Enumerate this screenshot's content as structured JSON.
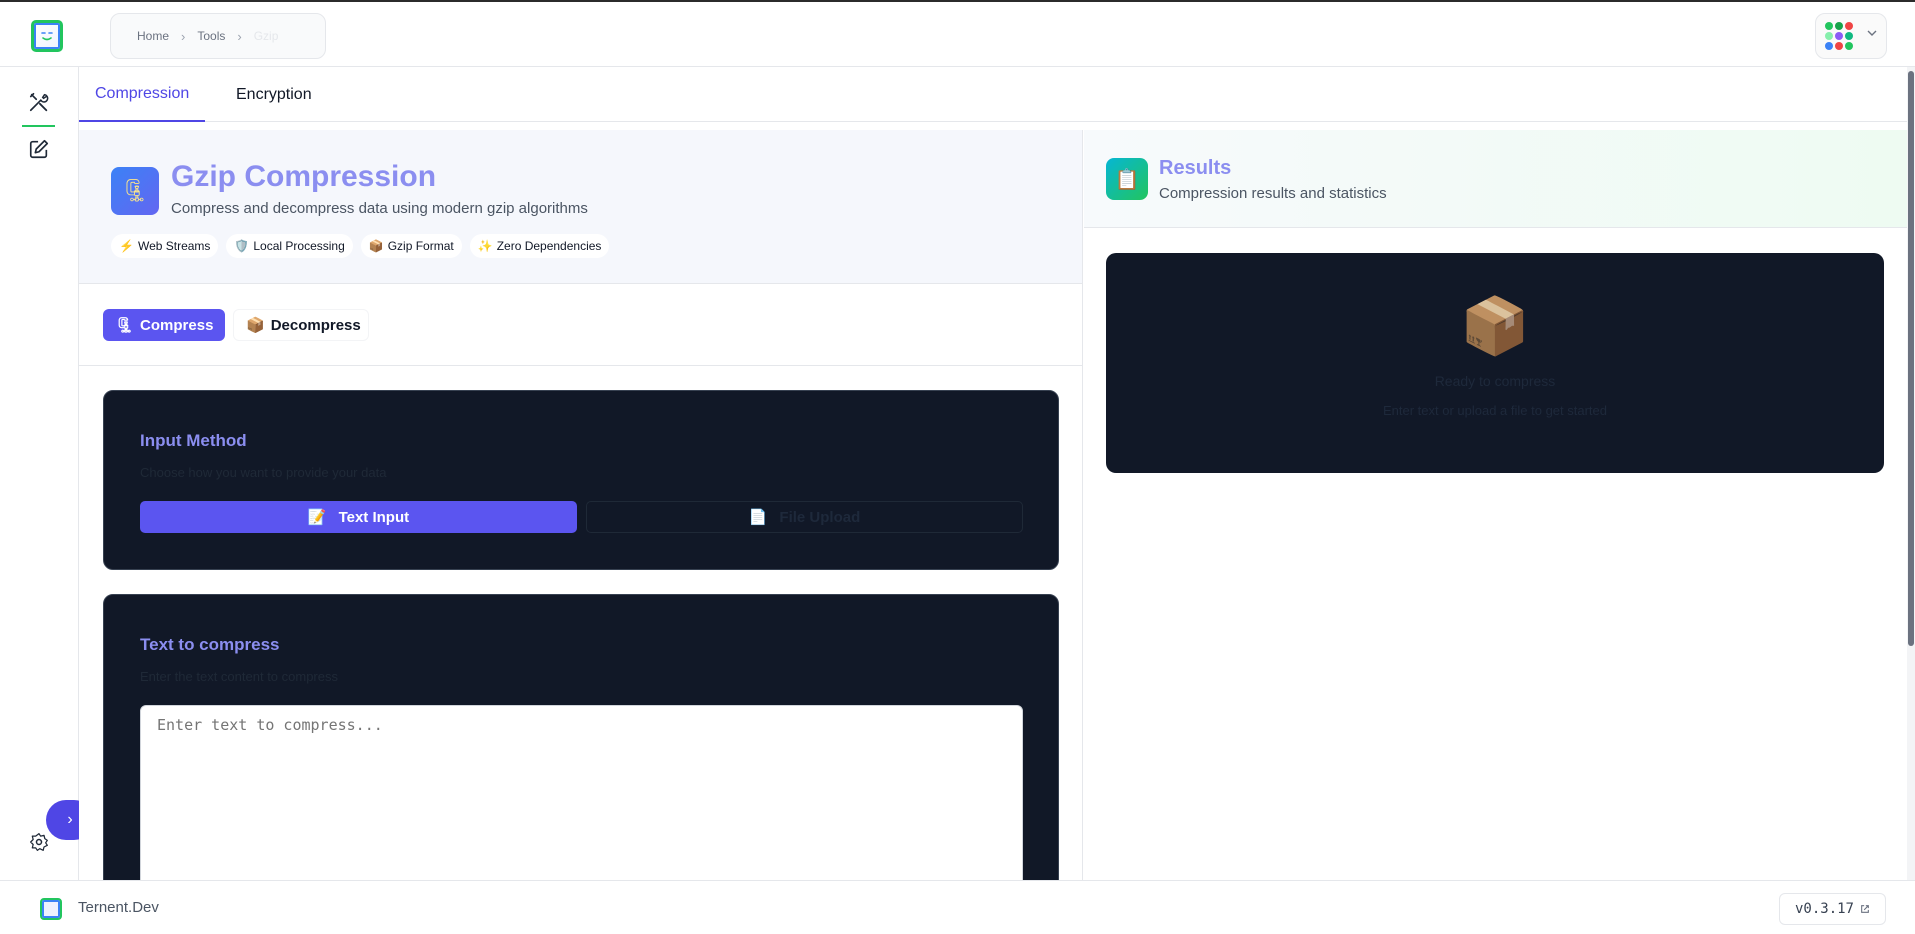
{
  "header": {
    "breadcrumb": [
      "Home",
      "Tools",
      "Gzip"
    ],
    "apps_dot_colors": [
      "#22c55e",
      "#16a34a",
      "#ef4444",
      "#86efac",
      "#8b5cf6",
      "#10b981",
      "#3b82f6",
      "#ef4444",
      "#22c55e"
    ]
  },
  "tabs": [
    {
      "label": "Compression",
      "active": true
    },
    {
      "label": "Encryption",
      "active": false
    }
  ],
  "tool": {
    "icon": "🗜",
    "title": "Gzip Compression",
    "subtitle": "Compress and decompress data using modern gzip algorithms",
    "features": [
      {
        "icon": "⚡",
        "label": "Web Streams"
      },
      {
        "icon": "🛡️",
        "label": "Local Processing"
      },
      {
        "icon": "📦",
        "label": "Gzip Format"
      },
      {
        "icon": "✨",
        "label": "Zero Dependencies"
      }
    ]
  },
  "modes": {
    "compress": {
      "icon": "🗜",
      "label": "Compress"
    },
    "decompress": {
      "icon": "📦",
      "label": "Decompress"
    }
  },
  "input_method": {
    "title": "Input Method",
    "description": "Choose how you want to provide your data",
    "text_input": {
      "icon": "📝",
      "label": "Text Input"
    },
    "file_upload": {
      "icon": "📄",
      "label": "File Upload"
    }
  },
  "text_section": {
    "title": "Text to compress",
    "description": "Enter the text content to compress",
    "placeholder": "Enter text to compress..."
  },
  "results": {
    "icon": "📋",
    "title": "Results",
    "subtitle": "Compression results and statistics",
    "empty_icon": "📦",
    "empty_title": "Ready to compress",
    "empty_desc": "Enter text or upload a file to get started"
  },
  "footer": {
    "brand": "Ternent.Dev",
    "version": "v0.3.17"
  },
  "colors": {
    "accent": "#5b55f0",
    "title_purple": "#8b8ef0",
    "rail_active": "#22c55e",
    "dark_card": "#111827"
  }
}
